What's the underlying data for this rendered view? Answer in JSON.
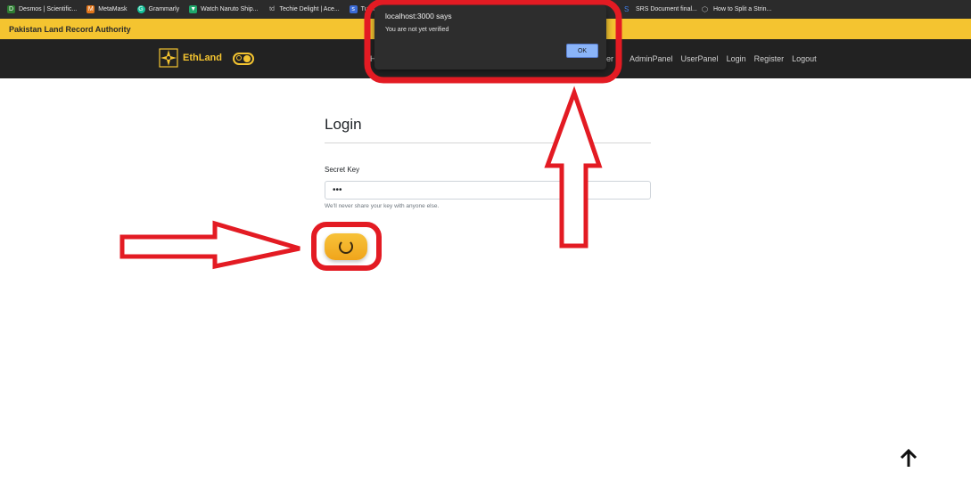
{
  "browser": {
    "bookmarks": [
      {
        "label": "Desmos | Scientific...",
        "icon": "desmos-icon",
        "color": "#2e7d32"
      },
      {
        "label": "MetaMask",
        "icon": "metamask-icon",
        "color": "#e2761b"
      },
      {
        "label": "Grammarly",
        "icon": "grammarly-icon",
        "color": "#15c39a"
      },
      {
        "label": "Watch Naruto Ship...",
        "icon": "play-icon",
        "color": "#1fa86b"
      },
      {
        "label": "Techie Delight | Ace...",
        "icon": "td-icon",
        "color": "#555555"
      },
      {
        "label": "Tutoria",
        "icon": "tutorial-icon",
        "color": "#3b6bd6"
      }
    ],
    "bookmarks_right": [
      {
        "label": "SRS Document final...",
        "icon": "srs-icon",
        "color": "#3f7ee8"
      },
      {
        "label": "How to Split a Strin...",
        "icon": "cube-icon",
        "color": "#888888"
      }
    ]
  },
  "banner": {
    "title": "Pakistan Land Record Authority"
  },
  "navbar": {
    "brand": "EthLand",
    "clipped_left": "H",
    "clipped_right": "er",
    "links": [
      "AdminPanel",
      "UserPanel",
      "Login",
      "Register",
      "Logout"
    ]
  },
  "login": {
    "title": "Login",
    "label": "Secret Key",
    "value": "•••",
    "help": "We'll never share your key with anyone else."
  },
  "alert": {
    "title": "localhost:3000 says",
    "message": "You are not yet verified",
    "ok_label": "OK"
  },
  "colors": {
    "accent": "#f4c430",
    "navbar": "#222222",
    "annotation": "#e31b23"
  }
}
